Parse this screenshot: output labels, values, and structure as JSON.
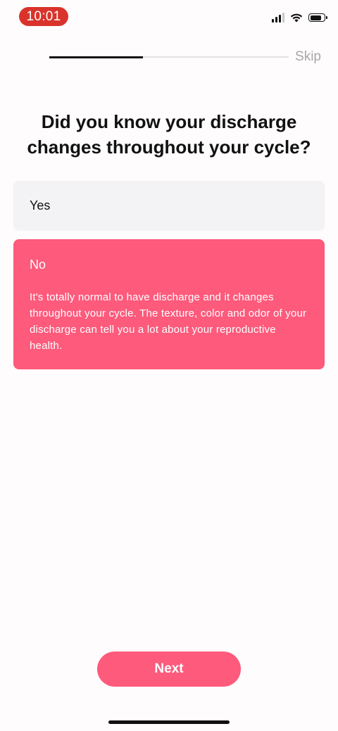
{
  "status_bar": {
    "time": "10:01",
    "icons": [
      "cellular-signal-icon",
      "wifi-icon",
      "battery-icon"
    ]
  },
  "progress": {
    "fraction": 0.39,
    "skip_label": "Skip"
  },
  "question": {
    "title": "Did you know your discharge changes throughout your cycle?"
  },
  "options": [
    {
      "label": "Yes",
      "selected": false
    },
    {
      "label": "No",
      "selected": true,
      "description": "It's totally normal to have discharge and it changes throughout your cycle. The texture, color and odor of your discharge can tell you a lot about your reproductive health."
    }
  ],
  "footer": {
    "next_label": "Next"
  },
  "colors": {
    "accent": "#fd5a7c",
    "time_pill": "#d9332b",
    "option_unselected": "#f3f2f4",
    "skip_text": "#a9a6a9"
  }
}
